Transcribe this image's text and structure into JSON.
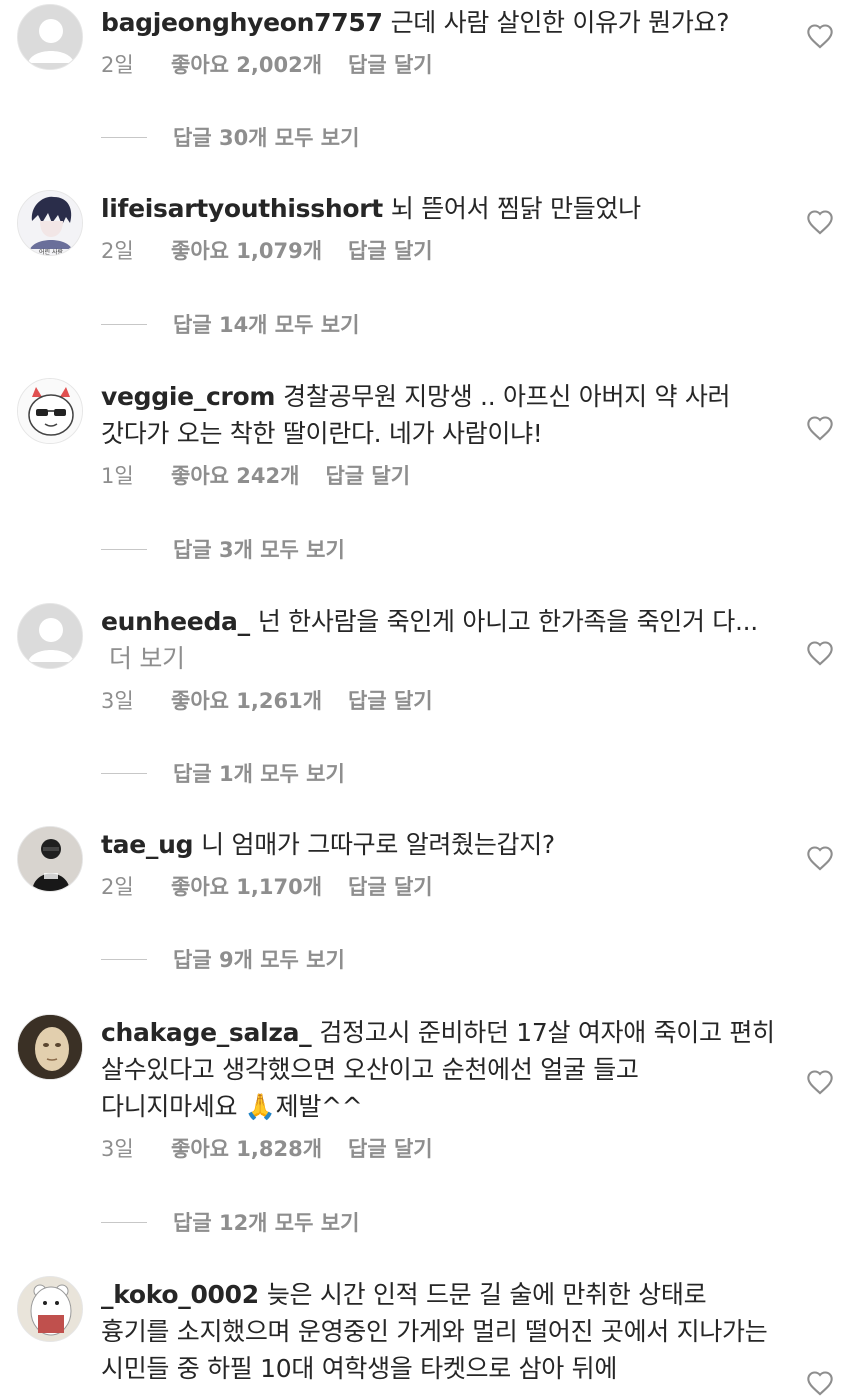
{
  "comments": [
    {
      "username": "bagjeonghyeon7757",
      "text": "근데 사람 살인한 이유가 뭔가요?",
      "more": "",
      "time": "2일",
      "likes": "좋아요 2,002개",
      "reply": "답글 달기",
      "view_replies": "답글 30개 모두 보기",
      "avatar": "default-avatar"
    },
    {
      "username": "lifeisartyouthisshort",
      "text": "뇌 뜯어서 찜닭 만들었나",
      "more": "",
      "time": "2일",
      "likes": "좋아요 1,079개",
      "reply": "답글 달기",
      "view_replies": "답글 14개 모두 보기",
      "avatar": "anime-drawing-avatar",
      "avatar_caption": "어린 사람"
    },
    {
      "username": "veggie_crom",
      "text": "경찰공무원 지망생 .. 아프신 아버지 약 사러 갓다가 오는 착한 딸이란다. 네가 사람이냐!",
      "more": "",
      "time": "1일",
      "likes": "좋아요 242개",
      "reply": "답글 달기",
      "view_replies": "답글 3개 모두 보기",
      "avatar": "devil-cartoon-avatar"
    },
    {
      "username": "eunheeda_",
      "text": "넌 한사람을 죽인게 아니고 한가족을 죽인거 다...",
      "more": "더 보기",
      "time": "3일",
      "likes": "좋아요 1,261개",
      "reply": "답글 달기",
      "view_replies": "답글 1개 모두 보기",
      "avatar": "default-avatar"
    },
    {
      "username": "tae_ug",
      "text": "니 엄매가 그따구로 알려줬는갑지?",
      "more": "",
      "time": "2일",
      "likes": "좋아요 1,170개",
      "reply": "답글 달기",
      "view_replies": "답글 9개 모두 보기",
      "avatar": "person-photo-avatar"
    },
    {
      "username": "chakage_salza_",
      "text": "검정고시 준비하던 17살 여자애 죽이고 편히 살수있다고 생각했으면 오산이고 순천에선 얼굴 들고 다니지마세요 🙏제발^^",
      "more": "",
      "time": "3일",
      "likes": "좋아요 1,828개",
      "reply": "답글 달기",
      "view_replies": "답글 12개 모두 보기",
      "avatar": "painting-portrait-avatar"
    },
    {
      "username": "_koko_0002",
      "text": "늦은 시간 인적 드문 길 술에 만취한 상태로 흉기를 소지했으며 운영중인 가게와 멀리 떨어진 곳에서 지나가는 시민들 중 하필 10대 여학생을 타켓으로 삼아 뒤에",
      "more": "",
      "time": "",
      "likes": "",
      "reply": "",
      "view_replies": "",
      "avatar": "bear-cartoon-avatar"
    }
  ],
  "colors": {
    "text": "#262626",
    "secondary": "#8e8e8e",
    "divider": "#c7c7c7"
  }
}
